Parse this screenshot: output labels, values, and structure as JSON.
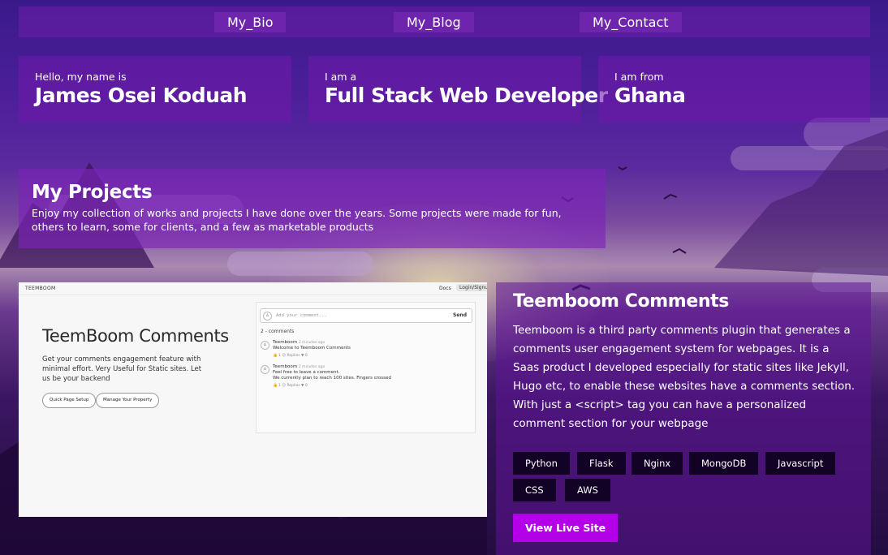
{
  "nav": {
    "links": [
      "My_Bio",
      "My_Blog",
      "My_Contact"
    ]
  },
  "intro": [
    {
      "label": "Hello, my name is",
      "value": "James Osei Koduah"
    },
    {
      "label": "I am a",
      "value": "Full Stack Web Developer"
    },
    {
      "label": "I am from",
      "value": "Ghana"
    }
  ],
  "projects": {
    "title": "My Projects",
    "description": "Enjoy my collection of works and projects I have done over the years. Some projects were made for fun, others to learn, some for clients, and a few as marketable products"
  },
  "preview": {
    "brand": "TEEMBOOM",
    "docs": "Docs",
    "login": "Login/Signup",
    "title": "TeemBoom Comments",
    "description": "Get your comments engagement feature with minimal effort. Very Useful for Static sites. Let us be your backend",
    "buttons": [
      "Quick Page Setup",
      "Manage Your Property"
    ],
    "input_placeholder": "Add your comment...",
    "send": "Send",
    "count": "2 - comments",
    "comments": [
      {
        "author": "Teemboom",
        "time": "2 minutes ago",
        "text": "Welcome to Teemboom Comments",
        "actions": "👍 1   😐   Replies ▼ 0"
      },
      {
        "author": "Teemboom",
        "time": "2 minutes ago",
        "text": "Feel free to leave a comment.\nWe currently plan to reach 100 sites. Fingers crossed",
        "actions": "👍 1   😐   Replies ▼ 0"
      }
    ]
  },
  "project": {
    "title": "Teemboom Comments",
    "description": "Teemboom is a third party comments plugin that generates a comments user engagement system for webpages. It is a Saas product I developed especially for static sites like Jekyll, Hugo etc, to enable these websites have a comments section. With just a <script> tag you can have a personalized comment section for your webpage",
    "tags": [
      "Python",
      "Flask",
      "Nginx",
      "MongoDB",
      "Javascript",
      "CSS",
      "AWS"
    ],
    "live_button": "View Live Site"
  },
  "colors": {
    "accent": "#b400e8",
    "tag_bg": "#120326"
  }
}
